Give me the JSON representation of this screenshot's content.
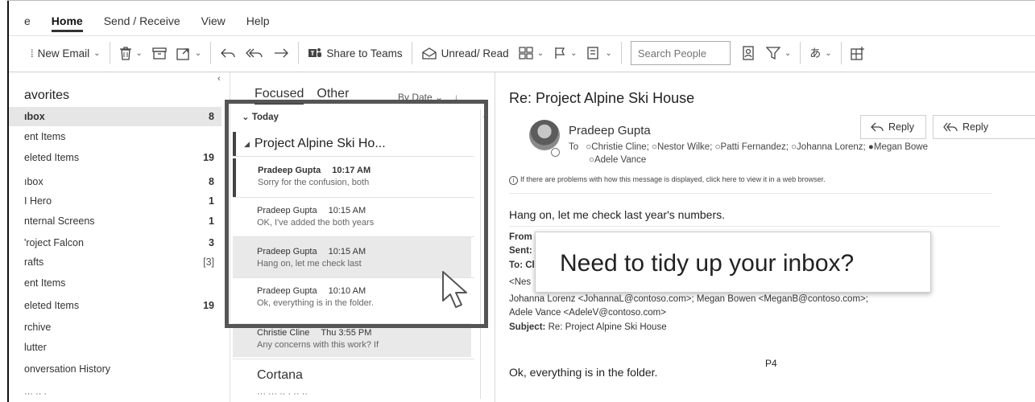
{
  "ribbon": {
    "tabs": [
      "e",
      "Home",
      "Send / Receive",
      "View",
      "Help"
    ],
    "active_tab": "Home"
  },
  "toolbar": {
    "new_email": "New Email",
    "share_to_teams": "Share to Teams",
    "unread_read": "Unread/ Read",
    "search_placeholder": "Search People"
  },
  "folders": {
    "header": "avorites",
    "items": [
      {
        "label": "ıbox",
        "count": "8"
      },
      {
        "label": "ent Items",
        "count": ""
      },
      {
        "label": "eleted Items",
        "count": "19"
      },
      {
        "label": "ıbox",
        "count": "8"
      },
      {
        "label": "I Hero",
        "count": "1"
      },
      {
        "label": "nternal Screens",
        "count": "1"
      },
      {
        "label": "'roject Falcon",
        "count": "3"
      },
      {
        "label": "rafts",
        "count": "[3]"
      },
      {
        "label": "ent Items",
        "count": ""
      },
      {
        "label": "eleted Items",
        "count": "19"
      },
      {
        "label": "rchive",
        "count": ""
      },
      {
        "label": "lutter",
        "count": ""
      },
      {
        "label": "onversation History",
        "count": ""
      }
    ]
  },
  "list": {
    "tabs": [
      "Focused",
      "Other"
    ],
    "sort": "By Date",
    "group": "Today",
    "conversation": "Project Alpine Ski Ho...",
    "messages": [
      {
        "sender": "Pradeep Gupta",
        "time": "10:17 AM",
        "preview": "Sorry for the confusion, both"
      },
      {
        "sender": "Pradeep Gupta",
        "time": "10:15 AM",
        "preview": "OK, I've added the both years"
      },
      {
        "sender": "Pradeep Gupta",
        "time": "10:15 AM",
        "preview": "Hang on, let me check last"
      },
      {
        "sender": "Pradeep Gupta",
        "time": "10:10 AM",
        "preview": "Ok, everything is in the folder."
      },
      {
        "sender": "Christie Cline",
        "time": "Thu 3:55 PM",
        "preview": "Any concerns with this work? If"
      }
    ],
    "next_sender": "Cortana"
  },
  "reading": {
    "subject": "Re: Project Alpine Ski House",
    "sender": "Pradeep Gupta",
    "to_label": "To",
    "recipients": "○Christie Cline; ○Nestor Wilke; ○Patti Fernandez; ○Johanna Lorenz; ●Megan Bowe",
    "recipients2": "○Adele Vance",
    "reply": "Reply",
    "reply_all": "Reply",
    "info": "If there are problems with how this message is displayed, click here to view it in a web browser.",
    "greeting": "Hang on, let me check last year's numbers.",
    "from_label": "From",
    "sent_label": "Sent:",
    "to_hdr": "To: Cl",
    "nes": "<Nes",
    "johanna_line": "Johanna Lorenz <JohannaL@contoso.com>; Megan Bowen <MeganB@contoso.com>;",
    "adele_line": "Adele Vance <AdeleV@contoso.com>",
    "subject_label": "Subject:",
    "subject_value": "Re: Project Alpine Ski House",
    "body": "Ok, everything is in the folder.",
    "tooltip": "Need to tidy up your inbox?",
    "page_label": "P4"
  }
}
